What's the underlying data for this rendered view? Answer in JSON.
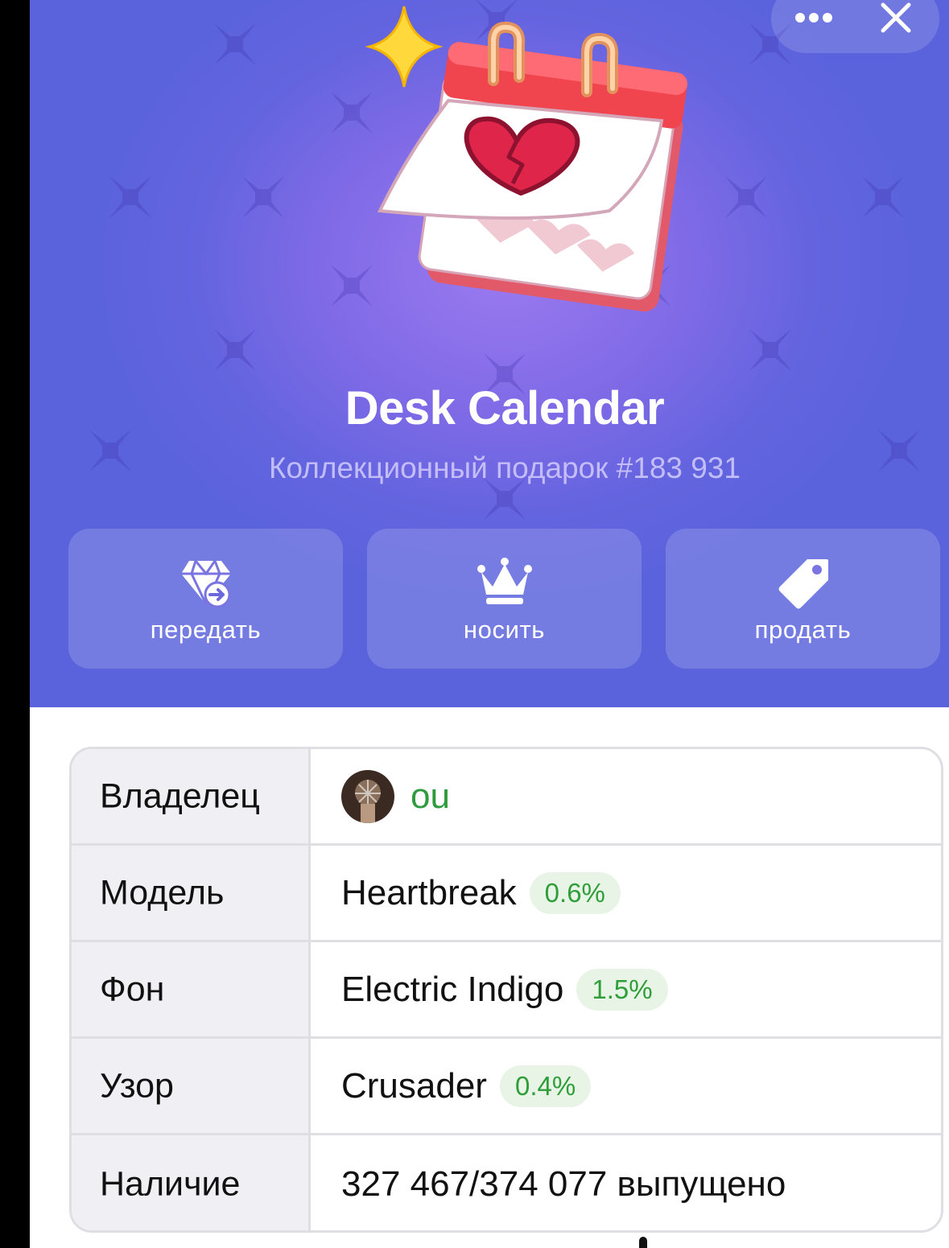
{
  "gift": {
    "title": "Desk Calendar",
    "subtitle": "Коллекционный подарок #183 931"
  },
  "header": {
    "more_icon": "more-dots-icon",
    "close_icon": "close-icon"
  },
  "actions": [
    {
      "label": "передать",
      "icon": "diamond-transfer-icon"
    },
    {
      "label": "носить",
      "icon": "crown-icon"
    },
    {
      "label": "продать",
      "icon": "price-tag-icon"
    }
  ],
  "details": {
    "owner": {
      "label": "Владелец",
      "name": "ou"
    },
    "model": {
      "label": "Модель",
      "value": "Heartbreak",
      "rarity": "0.6%"
    },
    "backdrop": {
      "label": "Фон",
      "value": "Electric Indigo",
      "rarity": "1.5%"
    },
    "pattern": {
      "label": "Узор",
      "value": "Crusader",
      "rarity": "0.4%"
    },
    "availability": {
      "label": "Наличие",
      "value": "327 467/374 077 выпущено"
    }
  },
  "colors": {
    "backdrop_center": "#9b7af0",
    "backdrop_edge": "#5a63dc",
    "rarity_text": "#2f9e3a",
    "rarity_bg": "#e8f5e6",
    "owner_link": "#2e9b3c"
  }
}
